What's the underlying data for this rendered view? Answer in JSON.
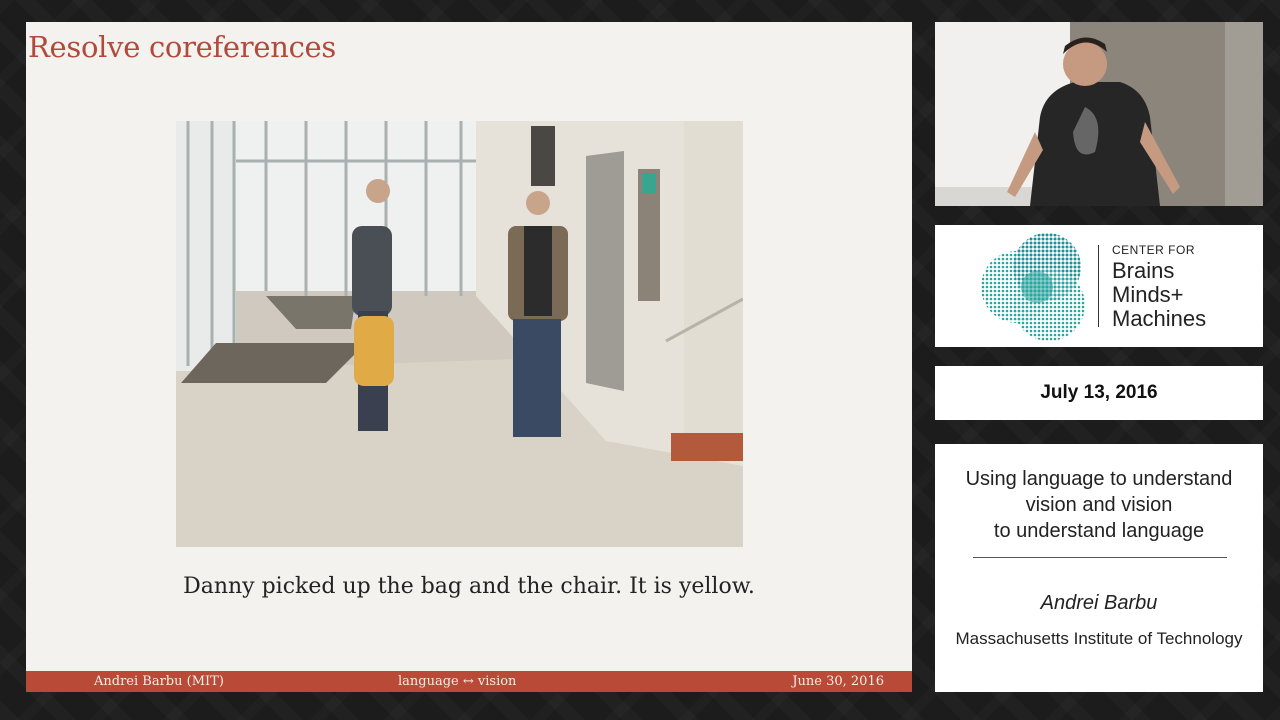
{
  "slide": {
    "title": "Resolve coreferences",
    "caption": "Danny picked up the bag and the chair. It is yellow.",
    "footer": {
      "author": "Andrei Barbu (MIT)",
      "topic": "language ↔ vision",
      "date": "June 30, 2016"
    }
  },
  "logo": {
    "small": "CENTER FOR",
    "line1": "Brains",
    "line2": "Minds+",
    "line3": "Machines"
  },
  "event_date": "July 13, 2016",
  "talk": {
    "title_lines": [
      "Using language to understand",
      "vision and vision",
      "to understand language"
    ],
    "speaker": "Andrei Barbu",
    "affiliation": "Massachusetts Institute of Technology"
  },
  "colors": {
    "accent": "#b84a37",
    "title": "#b24a3b",
    "logo_teal": "#2aa6a0"
  }
}
